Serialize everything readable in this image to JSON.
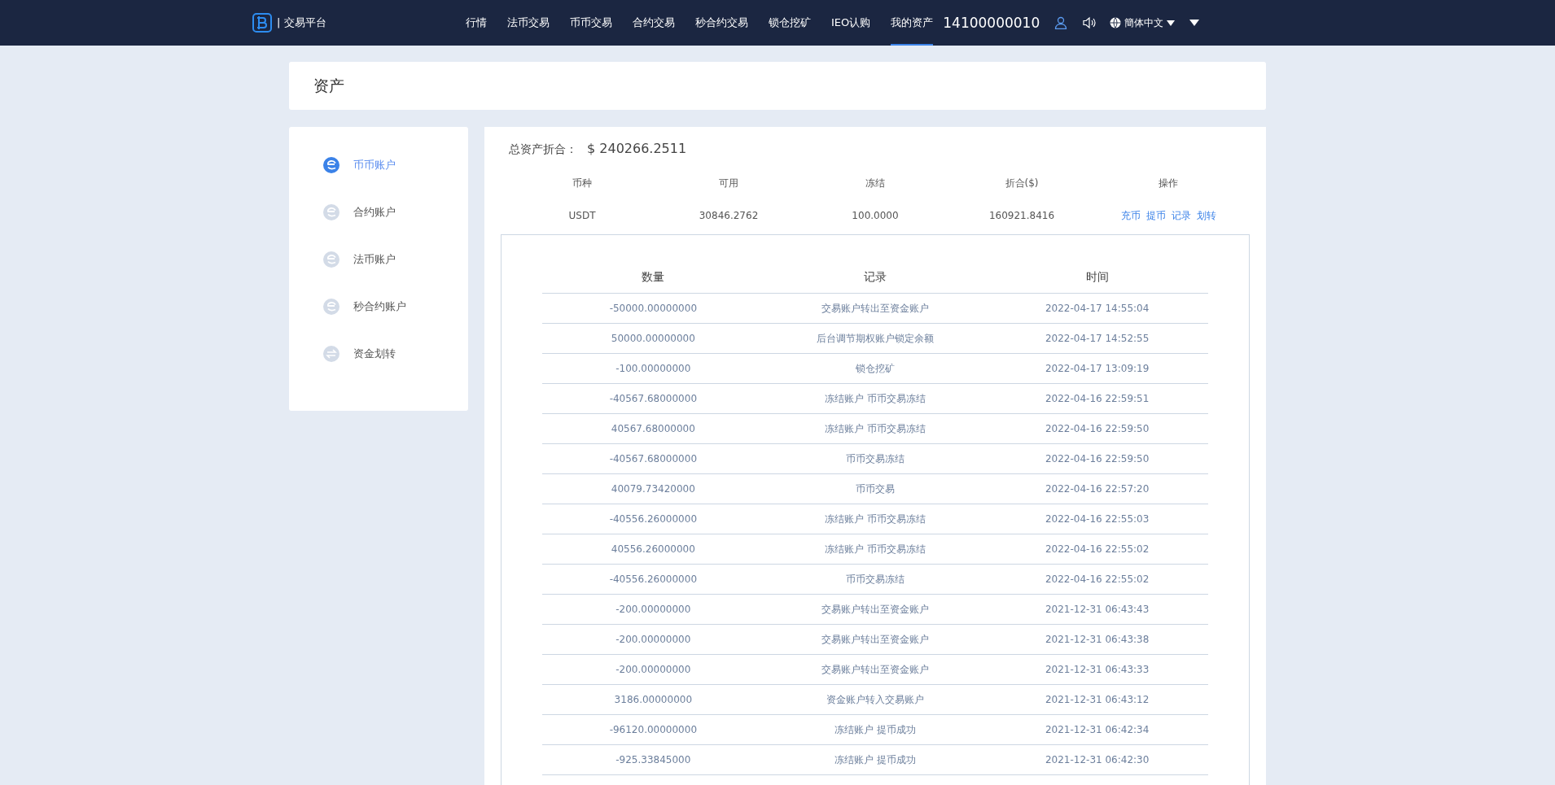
{
  "header": {
    "brand": "| 交易平台",
    "nav": [
      {
        "label": "行情",
        "selected": false
      },
      {
        "label": "法币交易",
        "selected": false
      },
      {
        "label": "币币交易",
        "selected": false
      },
      {
        "label": "合约交易",
        "selected": false
      },
      {
        "label": "秒合约交易",
        "selected": false
      },
      {
        "label": "锁仓挖矿",
        "selected": false
      },
      {
        "label": "IEO认购",
        "selected": false
      },
      {
        "label": "我的资产",
        "selected": true
      }
    ],
    "account": "14100000010",
    "language": "簡体中文"
  },
  "page_title": "资产",
  "sidebar": {
    "items": [
      {
        "label": "币币账户",
        "selected": true,
        "kind": "account"
      },
      {
        "label": "合约账户",
        "selected": false,
        "kind": "account"
      },
      {
        "label": "法币账户",
        "selected": false,
        "kind": "account"
      },
      {
        "label": "秒合约账户",
        "selected": false,
        "kind": "account"
      },
      {
        "label": "资金划转",
        "selected": false,
        "kind": "transfer"
      }
    ]
  },
  "summary": {
    "label": "总资产折合：",
    "value": "$ 240266.2511"
  },
  "balances": {
    "columns": [
      "币种",
      "可用",
      "冻结",
      "折合($)",
      "操作"
    ],
    "rows": [
      {
        "coin": "USDT",
        "available": "30846.2762",
        "frozen": "100.0000",
        "value": "160921.8416",
        "actions": [
          "充币",
          "提币",
          "记录",
          "划转"
        ]
      }
    ]
  },
  "records": {
    "columns": [
      "数量",
      "记录",
      "时间"
    ],
    "rows": [
      {
        "amount": "-50000.00000000",
        "record": "交易账户转出至资金账户",
        "time": "2022-04-17 14:55:04"
      },
      {
        "amount": "50000.00000000",
        "record": "后台调节期权账户锁定余额",
        "time": "2022-04-17 14:52:55"
      },
      {
        "amount": "-100.00000000",
        "record": "锁仓挖矿",
        "time": "2022-04-17 13:09:19"
      },
      {
        "amount": "-40567.68000000",
        "record": "冻结账户 币币交易冻结",
        "time": "2022-04-16 22:59:51"
      },
      {
        "amount": "40567.68000000",
        "record": "冻结账户 币币交易冻结",
        "time": "2022-04-16 22:59:50"
      },
      {
        "amount": "-40567.68000000",
        "record": "币币交易冻结",
        "time": "2022-04-16 22:59:50"
      },
      {
        "amount": "40079.73420000",
        "record": "币币交易",
        "time": "2022-04-16 22:57:20"
      },
      {
        "amount": "-40556.26000000",
        "record": "冻结账户 币币交易冻结",
        "time": "2022-04-16 22:55:03"
      },
      {
        "amount": "40556.26000000",
        "record": "冻结账户 币币交易冻结",
        "time": "2022-04-16 22:55:02"
      },
      {
        "amount": "-40556.26000000",
        "record": "币币交易冻结",
        "time": "2022-04-16 22:55:02"
      },
      {
        "amount": "-200.00000000",
        "record": "交易账户转出至资金账户",
        "time": "2021-12-31 06:43:43"
      },
      {
        "amount": "-200.00000000",
        "record": "交易账户转出至资金账户",
        "time": "2021-12-31 06:43:38"
      },
      {
        "amount": "-200.00000000",
        "record": "交易账户转出至资金账户",
        "time": "2021-12-31 06:43:33"
      },
      {
        "amount": "3186.00000000",
        "record": "资金账户转入交易账户",
        "time": "2021-12-31 06:43:12"
      },
      {
        "amount": "-96120.00000000",
        "record": "冻结账户 提币成功",
        "time": "2021-12-31 06:42:34"
      },
      {
        "amount": "-925.33845000",
        "record": "冻结账户 提币成功",
        "time": "2021-12-31 06:42:30"
      }
    ]
  }
}
